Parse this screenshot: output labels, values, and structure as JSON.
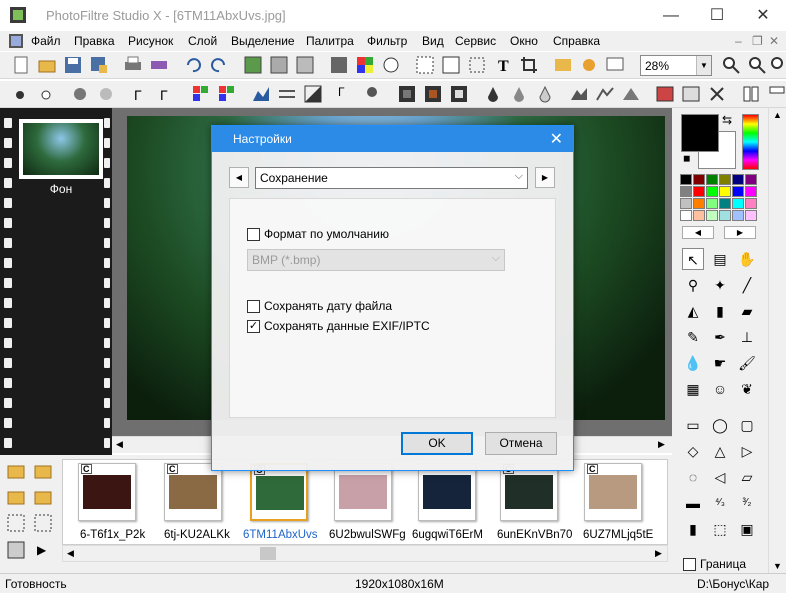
{
  "window": {
    "title": "PhotoFiltre Studio X - [6TM11AbxUvs.jpg]",
    "minimize": "—",
    "maximize": "☐",
    "close": "✕"
  },
  "menu": [
    "Файл",
    "Правка",
    "Рисунок",
    "Слой",
    "Выделение",
    "Палитра",
    "Фильтр",
    "Вид",
    "Сервис",
    "Окно",
    "Справка"
  ],
  "menu_controls": {
    "minimize": "–",
    "restore": "❐",
    "close": "✕"
  },
  "toolbar": {
    "zoom_value": "28%"
  },
  "document": {
    "thumbnail_label": "Фон"
  },
  "dialog": {
    "title": "Настройки",
    "category": "Сохранение",
    "default_format_label": "Формат по умолчанию",
    "default_format_checked": false,
    "format_value": "BMP (*.bmp)",
    "keep_date_label": "Сохранять дату файла",
    "keep_date_checked": false,
    "keep_exif_label": "Сохранять данные EXIF/IPTC",
    "keep_exif_checked": true,
    "ok": "OK",
    "cancel": "Отмена"
  },
  "filmstrip": [
    {
      "label": "6-T6f1x_P2k",
      "badge": "C",
      "color": "#3a1512",
      "selected": false
    },
    {
      "label": "6tj-KU2ALKk",
      "badge": "C",
      "color": "#8a6a45",
      "selected": false
    },
    {
      "label": "6TM11AbxUvs",
      "badge": "C",
      "color": "#2f6a3a",
      "selected": true
    },
    {
      "label": "6U2bwulSWFg",
      "badge": "",
      "color": "#c8a0a8",
      "selected": false
    },
    {
      "label": "6ugqwiT6ErM",
      "badge": "",
      "color": "#15243a",
      "selected": false
    },
    {
      "label": "6unEKnVBn70",
      "badge": "C",
      "color": "#203028",
      "selected": false
    },
    {
      "label": "6UZ7MLjq5tE",
      "badge": "C",
      "color": "#b89a80",
      "selected": false
    }
  ],
  "right_panel": {
    "border_label": "Граница",
    "border_checked": false
  },
  "status": {
    "state": "Готовность",
    "size": "1920x1080x16M",
    "path": "D:\\Бонус\\Кар"
  },
  "colors": {
    "accent": "#2b8be6",
    "selected_label": "#1e63c8"
  }
}
